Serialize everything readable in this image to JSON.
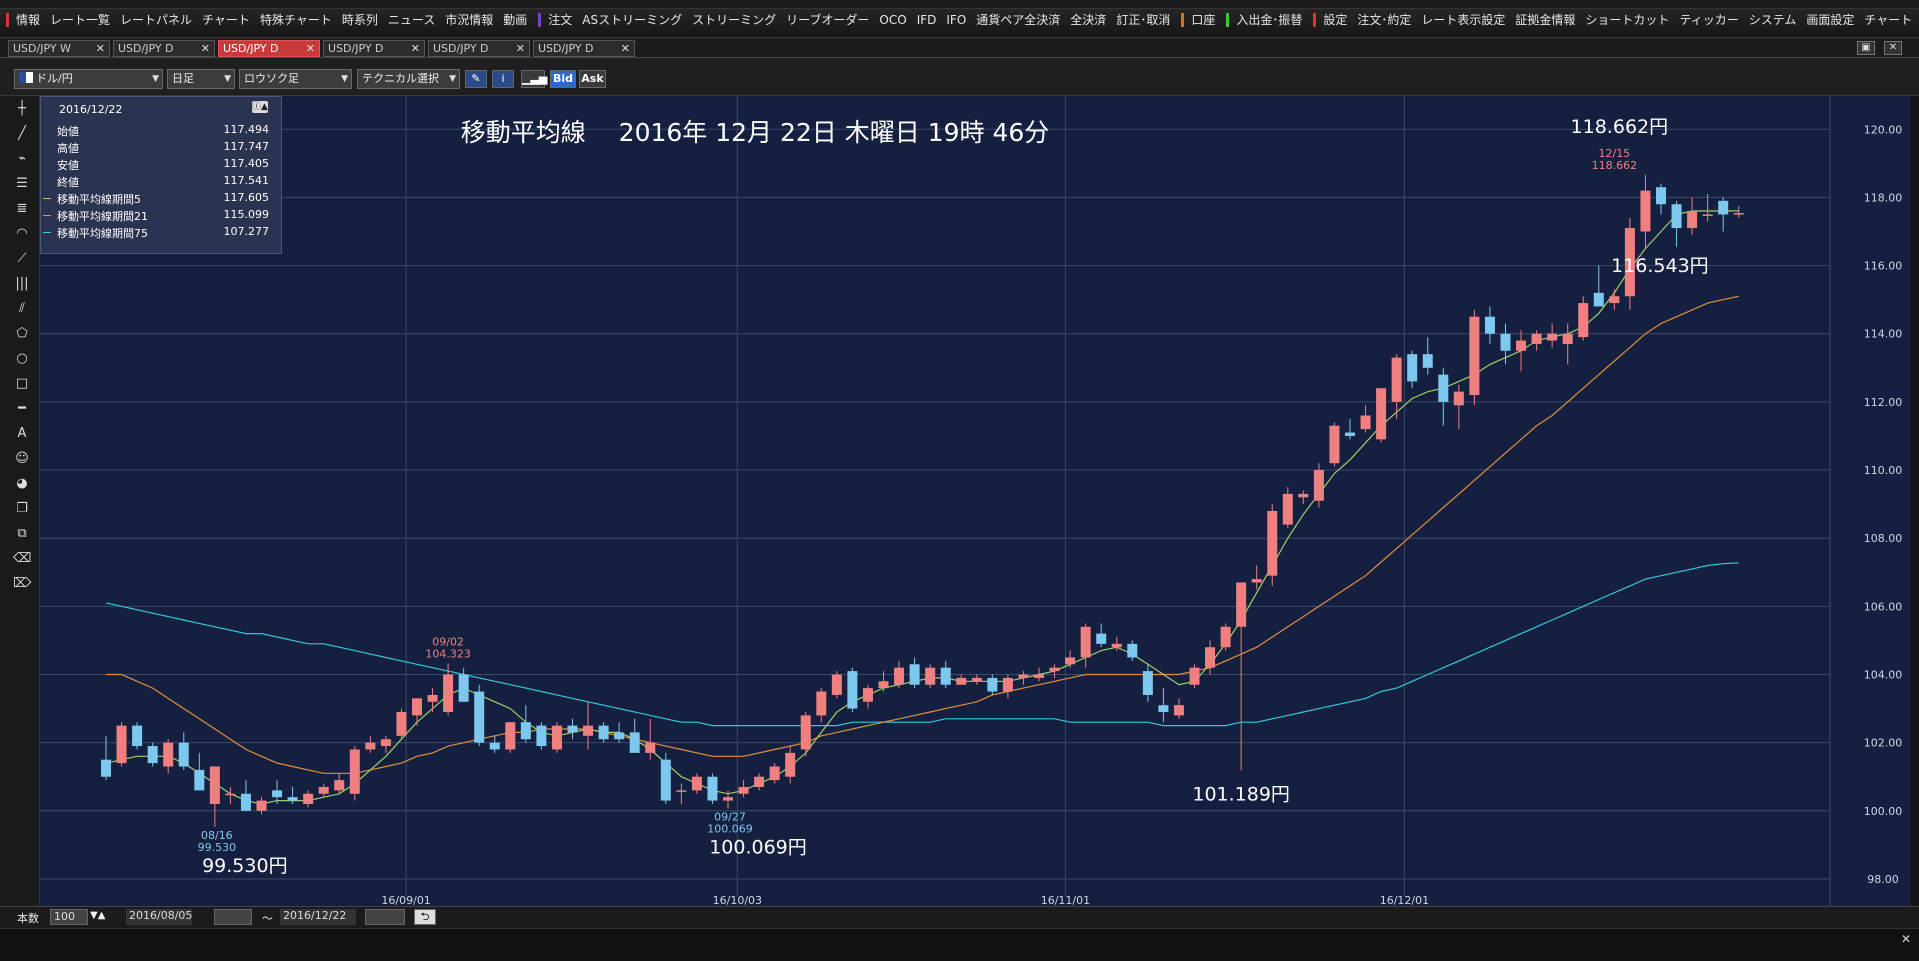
{
  "menu": {
    "items": [
      {
        "label": "情報",
        "mark": "#d33"
      },
      {
        "label": "レート一覧"
      },
      {
        "label": "レートパネル"
      },
      {
        "label": "チャート"
      },
      {
        "label": "特殊チャート"
      },
      {
        "label": "時系列"
      },
      {
        "label": "ニュース"
      },
      {
        "label": "市況情報"
      },
      {
        "label": "動画"
      },
      {
        "label": "注文",
        "mark": "#7a3fd0"
      },
      {
        "label": "ASストリーミング"
      },
      {
        "label": "ストリーミング"
      },
      {
        "label": "リーブオーダー"
      },
      {
        "label": "OCO"
      },
      {
        "label": "IFD"
      },
      {
        "label": "IFO"
      },
      {
        "label": "通貨ペア全決済"
      },
      {
        "label": "全決済"
      },
      {
        "label": "訂正･取消"
      },
      {
        "label": "口座",
        "mark": "#e07020"
      },
      {
        "label": "入出金･振替",
        "mark": "#3c3"
      },
      {
        "label": "設定",
        "mark": "#d33"
      },
      {
        "label": "注文･約定"
      },
      {
        "label": "レート表示設定"
      },
      {
        "label": "証拠金情報"
      },
      {
        "label": "ショートカット"
      },
      {
        "label": "ティッカー"
      },
      {
        "label": "システム"
      },
      {
        "label": "画面設定"
      },
      {
        "label": "チャート"
      }
    ]
  },
  "tabs": [
    {
      "label": "USD/JPY W",
      "active": false
    },
    {
      "label": "USD/JPY D",
      "active": false
    },
    {
      "label": "USD/JPY D",
      "active": true
    },
    {
      "label": "USD/JPY D",
      "active": false
    },
    {
      "label": "USD/JPY D",
      "active": false
    },
    {
      "label": "USD/JPY D",
      "active": false
    }
  ],
  "toolbar": {
    "currency_pair": "ドル/円",
    "period": "日足",
    "chart_type": "ロウソク足",
    "technical": "テクニカル選択",
    "bid": "Bid",
    "ask": "Ask"
  },
  "info_panel": {
    "date": "2016/12/22",
    "rows": [
      {
        "label": "始値",
        "value": "117.494",
        "color": ""
      },
      {
        "label": "高値",
        "value": "117.747",
        "color": ""
      },
      {
        "label": "安値",
        "value": "117.405",
        "color": ""
      },
      {
        "label": "終値",
        "value": "117.541",
        "color": ""
      },
      {
        "label": "移動平均線期間5",
        "value": "117.605",
        "color": "#9ecf6a"
      },
      {
        "label": "移動平均線期間21",
        "value": "115.099",
        "color": "#e0903a"
      },
      {
        "label": "移動平均線期間75",
        "value": "107.277",
        "color": "#35c8d8"
      }
    ]
  },
  "chart_data": {
    "type": "candlestick",
    "title": "移動平均線　 2016年 12月 22日 木曜日 19時 46分",
    "ylim": [
      97.5,
      120.8
    ],
    "y_ticks": [
      "120.00",
      "118.00",
      "116.00",
      "114.00",
      "112.00",
      "110.00",
      "108.00",
      "106.00",
      "104.00",
      "102.00",
      "100.00",
      "98.00"
    ],
    "x_ticks": [
      {
        "label": "16/09/01",
        "index": 19.3
      },
      {
        "label": "16/10/03",
        "index": 40.6
      },
      {
        "label": "16/11/01",
        "index": 61.7
      },
      {
        "label": "16/12/01",
        "index": 83.5
      }
    ],
    "colors": {
      "up": "#f08080",
      "down": "#7cc8ee",
      "ma5": "#9ecf6a",
      "ma21": "#e0903a",
      "ma75": "#35c8d8",
      "bg": "#152040",
      "grid": "#3a4a6a"
    },
    "candles": [
      [
        101.5,
        102.2,
        100.9,
        101.0
      ],
      [
        101.4,
        102.6,
        101.3,
        102.5
      ],
      [
        102.5,
        102.6,
        101.8,
        101.9
      ],
      [
        101.9,
        102.0,
        101.3,
        101.4
      ],
      [
        101.3,
        102.1,
        101.1,
        102.0
      ],
      [
        102.0,
        102.3,
        101.2,
        101.3
      ],
      [
        101.2,
        101.7,
        100.6,
        100.6
      ],
      [
        100.2,
        101.3,
        99.53,
        101.3
      ],
      [
        100.5,
        100.7,
        100.2,
        100.5
      ],
      [
        100.5,
        100.9,
        100.0,
        100.0
      ],
      [
        100.0,
        100.4,
        99.9,
        100.3
      ],
      [
        100.6,
        100.9,
        100.2,
        100.4
      ],
      [
        100.4,
        100.7,
        100.2,
        100.3
      ],
      [
        100.2,
        100.6,
        100.1,
        100.5
      ],
      [
        100.5,
        100.8,
        100.4,
        100.7
      ],
      [
        100.6,
        101.1,
        100.5,
        100.9
      ],
      [
        100.5,
        101.9,
        100.3,
        101.8
      ],
      [
        101.8,
        102.2,
        101.7,
        102.0
      ],
      [
        101.9,
        102.2,
        101.7,
        102.1
      ],
      [
        102.2,
        103.0,
        102.1,
        102.9
      ],
      [
        102.8,
        103.3,
        102.5,
        103.3
      ],
      [
        103.2,
        103.6,
        102.9,
        103.4
      ],
      [
        102.9,
        104.323,
        102.8,
        104.0
      ],
      [
        104.0,
        104.2,
        103.2,
        103.2
      ],
      [
        103.5,
        103.7,
        101.9,
        102.0
      ],
      [
        102.0,
        102.2,
        101.7,
        101.8
      ],
      [
        101.8,
        102.6,
        101.7,
        102.6
      ],
      [
        102.6,
        103.1,
        102.0,
        102.1
      ],
      [
        102.5,
        102.6,
        101.8,
        101.9
      ],
      [
        101.8,
        102.6,
        101.7,
        102.5
      ],
      [
        102.5,
        102.7,
        102.1,
        102.3
      ],
      [
        102.2,
        103.2,
        101.8,
        102.5
      ],
      [
        102.5,
        102.6,
        102.0,
        102.1
      ],
      [
        102.3,
        102.6,
        102.0,
        102.1
      ],
      [
        102.3,
        102.7,
        101.7,
        101.7
      ],
      [
        101.7,
        102.7,
        101.5,
        102.0
      ],
      [
        101.5,
        101.7,
        100.2,
        100.3
      ],
      [
        100.6,
        100.8,
        100.2,
        100.6
      ],
      [
        100.6,
        101.1,
        100.5,
        101.0
      ],
      [
        101.0,
        101.1,
        100.2,
        100.3
      ],
      [
        100.3,
        100.6,
        100.069,
        100.4
      ],
      [
        100.5,
        100.9,
        100.4,
        100.7
      ],
      [
        100.7,
        101.1,
        100.6,
        101.0
      ],
      [
        100.9,
        101.4,
        100.8,
        101.3
      ],
      [
        101.0,
        101.9,
        100.8,
        101.7
      ],
      [
        101.8,
        102.9,
        101.6,
        102.8
      ],
      [
        102.8,
        103.6,
        102.6,
        103.5
      ],
      [
        103.4,
        104.1,
        103.3,
        104.0
      ],
      [
        104.1,
        104.2,
        102.9,
        103.0
      ],
      [
        103.2,
        103.7,
        103.0,
        103.6
      ],
      [
        103.6,
        104.1,
        103.5,
        103.8
      ],
      [
        103.7,
        104.4,
        103.6,
        104.2
      ],
      [
        104.3,
        104.5,
        103.6,
        103.7
      ],
      [
        103.7,
        104.3,
        103.6,
        104.2
      ],
      [
        104.2,
        104.4,
        103.6,
        103.7
      ],
      [
        103.7,
        104.0,
        103.7,
        103.9
      ],
      [
        103.8,
        104.0,
        103.7,
        103.9
      ],
      [
        103.9,
        104.0,
        103.4,
        103.5
      ],
      [
        103.5,
        104.0,
        103.3,
        103.9
      ],
      [
        103.9,
        104.1,
        103.7,
        104.0
      ],
      [
        103.9,
        104.2,
        103.8,
        104.0
      ],
      [
        104.1,
        104.3,
        103.9,
        104.2
      ],
      [
        104.3,
        104.7,
        104.2,
        104.5
      ],
      [
        104.5,
        105.5,
        104.2,
        105.4
      ],
      [
        105.2,
        105.5,
        104.8,
        104.9
      ],
      [
        104.8,
        105.1,
        104.7,
        104.9
      ],
      [
        104.9,
        105.0,
        104.4,
        104.5
      ],
      [
        104.1,
        104.3,
        103.2,
        103.4
      ],
      [
        103.1,
        103.6,
        102.6,
        102.9
      ],
      [
        102.8,
        103.3,
        102.7,
        103.1
      ],
      [
        103.7,
        104.3,
        103.6,
        104.2
      ],
      [
        104.2,
        105.0,
        104.0,
        104.8
      ],
      [
        104.8,
        105.5,
        104.7,
        105.4
      ],
      [
        105.4,
        106.4,
        101.189,
        106.7
      ],
      [
        106.7,
        107.2,
        106.5,
        106.8
      ],
      [
        106.9,
        109.0,
        106.6,
        108.8
      ],
      [
        108.4,
        109.5,
        108.3,
        109.3
      ],
      [
        109.2,
        109.4,
        109.0,
        109.3
      ],
      [
        109.1,
        110.2,
        108.9,
        110.0
      ],
      [
        110.2,
        111.4,
        110.1,
        111.3
      ],
      [
        111.1,
        111.5,
        110.9,
        111.0
      ],
      [
        111.2,
        111.9,
        111.1,
        111.6
      ],
      [
        110.9,
        112.4,
        110.8,
        112.4
      ],
      [
        112.0,
        113.4,
        111.5,
        113.3
      ],
      [
        113.4,
        113.5,
        112.4,
        112.6
      ],
      [
        113.4,
        113.9,
        112.8,
        113.0
      ],
      [
        112.8,
        113.0,
        111.3,
        112.0
      ],
      [
        111.9,
        112.5,
        111.2,
        112.3
      ],
      [
        112.2,
        114.7,
        111.9,
        114.5
      ],
      [
        114.5,
        114.8,
        113.7,
        114.0
      ],
      [
        114.0,
        114.3,
        113.1,
        113.5
      ],
      [
        113.5,
        114.1,
        112.9,
        113.8
      ],
      [
        113.7,
        114.1,
        113.5,
        114.0
      ],
      [
        113.8,
        114.3,
        113.6,
        114.0
      ],
      [
        113.7,
        114.3,
        113.1,
        114.0
      ],
      [
        113.9,
        115.1,
        113.8,
        114.9
      ],
      [
        115.2,
        116.0,
        114.9,
        114.8
      ],
      [
        114.9,
        115.3,
        114.7,
        115.1
      ],
      [
        115.1,
        117.4,
        114.7,
        117.1
      ],
      [
        117.0,
        118.662,
        116.5,
        118.2
      ],
      [
        118.3,
        118.4,
        117.5,
        117.8
      ],
      [
        117.8,
        117.9,
        116.543,
        117.1
      ],
      [
        117.1,
        118.0,
        116.9,
        117.6
      ],
      [
        117.5,
        118.1,
        117.3,
        117.5
      ],
      [
        117.9,
        118.0,
        117.0,
        117.5
      ],
      [
        117.5,
        117.747,
        117.405,
        117.541
      ]
    ],
    "ma5": [
      101.4,
      101.5,
      101.6,
      101.6,
      101.6,
      101.4,
      101.1,
      100.8,
      100.5,
      100.3,
      100.2,
      100.3,
      100.3,
      100.3,
      100.4,
      100.5,
      100.8,
      101.2,
      101.6,
      102.1,
      102.6,
      103.0,
      103.4,
      103.6,
      103.4,
      103.2,
      103.0,
      102.6,
      102.3,
      102.2,
      102.3,
      102.4,
      102.3,
      102.3,
      102.1,
      101.8,
      101.4,
      101.0,
      100.8,
      100.6,
      100.5,
      100.6,
      100.8,
      101.0,
      101.3,
      101.7,
      102.3,
      102.9,
      103.2,
      103.4,
      103.6,
      103.7,
      103.8,
      103.9,
      103.9,
      103.8,
      103.8,
      103.8,
      103.8,
      103.9,
      104.0,
      104.1,
      104.3,
      104.5,
      104.7,
      104.8,
      104.6,
      104.3,
      104.0,
      103.7,
      103.8,
      104.3,
      104.9,
      105.6,
      106.4,
      107.2,
      108.0,
      108.7,
      109.3,
      109.9,
      110.3,
      110.8,
      111.3,
      111.7,
      112.1,
      112.3,
      112.4,
      112.6,
      112.8,
      113.1,
      113.3,
      113.5,
      113.8,
      113.9,
      114.0,
      114.2,
      114.6,
      115.2,
      115.9,
      116.5,
      117.0,
      117.5,
      117.6,
      117.6,
      117.6,
      117.605
    ],
    "ma21": [
      104.0,
      104.0,
      103.8,
      103.6,
      103.3,
      103.0,
      102.7,
      102.4,
      102.1,
      101.8,
      101.6,
      101.4,
      101.3,
      101.2,
      101.1,
      101.1,
      101.1,
      101.2,
      101.3,
      101.4,
      101.6,
      101.7,
      101.9,
      102.0,
      102.1,
      102.2,
      102.3,
      102.3,
      102.4,
      102.4,
      102.4,
      102.4,
      102.3,
      102.2,
      102.1,
      102.0,
      101.9,
      101.8,
      101.7,
      101.6,
      101.6,
      101.6,
      101.7,
      101.8,
      101.9,
      102.0,
      102.2,
      102.3,
      102.4,
      102.5,
      102.6,
      102.7,
      102.8,
      102.9,
      103.0,
      103.1,
      103.2,
      103.4,
      103.5,
      103.6,
      103.7,
      103.8,
      103.9,
      104.0,
      104.0,
      104.0,
      104.0,
      104.0,
      104.0,
      104.0,
      104.1,
      104.2,
      104.4,
      104.6,
      104.8,
      105.1,
      105.4,
      105.7,
      106.0,
      106.3,
      106.6,
      106.9,
      107.3,
      107.7,
      108.1,
      108.5,
      108.9,
      109.3,
      109.7,
      110.1,
      110.5,
      110.9,
      111.3,
      111.6,
      112.0,
      112.4,
      112.8,
      113.2,
      113.6,
      114.0,
      114.3,
      114.5,
      114.7,
      114.9,
      115.0,
      115.099
    ],
    "ma75": [
      106.1,
      106.0,
      105.9,
      105.8,
      105.7,
      105.6,
      105.5,
      105.4,
      105.3,
      105.2,
      105.2,
      105.1,
      105.0,
      104.9,
      104.9,
      104.8,
      104.7,
      104.6,
      104.5,
      104.4,
      104.3,
      104.2,
      104.1,
      104.0,
      103.9,
      103.8,
      103.7,
      103.6,
      103.5,
      103.4,
      103.3,
      103.2,
      103.1,
      103.0,
      102.9,
      102.8,
      102.7,
      102.6,
      102.6,
      102.5,
      102.5,
      102.5,
      102.5,
      102.5,
      102.5,
      102.5,
      102.5,
      102.5,
      102.6,
      102.6,
      102.6,
      102.6,
      102.6,
      102.6,
      102.7,
      102.7,
      102.7,
      102.7,
      102.7,
      102.7,
      102.7,
      102.7,
      102.6,
      102.6,
      102.6,
      102.6,
      102.6,
      102.6,
      102.5,
      102.5,
      102.5,
      102.5,
      102.5,
      102.6,
      102.6,
      102.7,
      102.8,
      102.9,
      103.0,
      103.1,
      103.2,
      103.3,
      103.5,
      103.6,
      103.8,
      104.0,
      104.2,
      104.4,
      104.6,
      104.8,
      105.0,
      105.2,
      105.4,
      105.6,
      105.8,
      106.0,
      106.2,
      106.4,
      106.6,
      106.8,
      106.9,
      107.0,
      107.1,
      107.2,
      107.25,
      107.277
    ],
    "annotations": [
      {
        "text": "99.530円",
        "index": 7,
        "price": 99.53,
        "dy": 45,
        "dx": 30,
        "size": 19,
        "color": "#ffffff"
      },
      {
        "text": "100.069円",
        "index": 40,
        "price": 100.069,
        "dy": 45,
        "dx": 30,
        "size": 19,
        "color": "#ffffff"
      },
      {
        "text": "101.189円",
        "index": 73,
        "price": 101.189,
        "dy": 30,
        "dx": 0,
        "size": 19,
        "color": "#ffffff"
      },
      {
        "text": "118.662円",
        "index": 97,
        "price": 118.662,
        "dy": -42,
        "dx": 5,
        "size": 19,
        "color": "#ffffff"
      },
      {
        "text": "116.543円",
        "index": 98,
        "price": 116.543,
        "dy": 25,
        "dx": 30,
        "size": 19,
        "color": "#ffffff"
      },
      {
        "text": "08/16",
        "index": 7,
        "price": 99.53,
        "dy": 12,
        "dx": 2,
        "size": 11,
        "color": "#7cc8ee"
      },
      {
        "text": "99.530",
        "index": 7,
        "price": 99.53,
        "dy": 24,
        "dx": 2,
        "size": 11,
        "color": "#7cc8ee"
      },
      {
        "text": "09/27",
        "index": 40,
        "price": 100.069,
        "dy": 12,
        "dx": 2,
        "size": 11,
        "color": "#7cc8ee"
      },
      {
        "text": "100.069",
        "index": 40,
        "price": 100.069,
        "dy": 24,
        "dx": 2,
        "size": 11,
        "color": "#7cc8ee"
      },
      {
        "text": "09/02",
        "index": 22,
        "price": 104.323,
        "dy": -18,
        "dx": 0,
        "size": 11,
        "color": "#f08080"
      },
      {
        "text": "104.323",
        "index": 22,
        "price": 104.323,
        "dy": -6,
        "dx": 0,
        "size": 11,
        "color": "#f08080"
      },
      {
        "text": "12/15",
        "index": 97,
        "price": 118.662,
        "dy": -18,
        "dx": 0,
        "size": 11,
        "color": "#f08080"
      },
      {
        "text": "118.662",
        "index": 97,
        "price": 118.662,
        "dy": -6,
        "dx": 0,
        "size": 11,
        "color": "#f08080"
      }
    ]
  },
  "bottom": {
    "count_label": "本数",
    "count_value": "100",
    "from_date": "2016/08/05",
    "to_date": "2016/12/22",
    "range_sep": "～"
  }
}
